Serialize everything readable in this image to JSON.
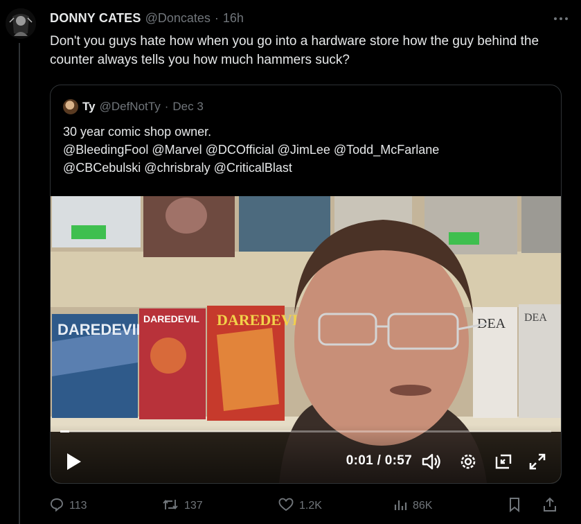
{
  "author": {
    "name": "DONNY CATES",
    "handle": "@Doncates",
    "separator": "·",
    "time": "16h"
  },
  "tweet_text": "Don't you guys hate how when you go into a hardware store how the guy behind the counter always tells you how much hammers suck?",
  "quoted": {
    "name": "Ty",
    "handle": "@DefNotTy",
    "separator": "·",
    "date": "Dec 3",
    "line1": "30 year comic shop owner.",
    "line2": "@BleedingFool @Marvel @DCOfficial @JimLee @Todd_McFarlane",
    "line3": "@CBCebulski @chrisbraly @CriticalBlast"
  },
  "video": {
    "time_readout": "0:01 / 0:57",
    "progress_fraction": 0.018,
    "comic_cover_texts": [
      "DAREDEVIL",
      "DAREDEVIL",
      "DAREDEVIL",
      "DEA",
      "DEA"
    ]
  },
  "actions": {
    "replies": "113",
    "retweets": "137",
    "likes": "1.2K",
    "views": "86K"
  },
  "icons": {
    "more": "more-icon",
    "reply": "reply-icon",
    "retweet": "retweet-icon",
    "like": "heart-icon",
    "views": "views-icon",
    "bookmark": "bookmark-icon",
    "share": "share-icon",
    "play": "play-icon",
    "volume": "volume-icon",
    "settings": "settings-icon",
    "pip": "pip-icon",
    "fullscreen": "fullscreen-icon"
  },
  "colors": {
    "background": "#000000",
    "text": "#e7e9ea",
    "secondary": "#71767b",
    "border": "#2f3336"
  }
}
